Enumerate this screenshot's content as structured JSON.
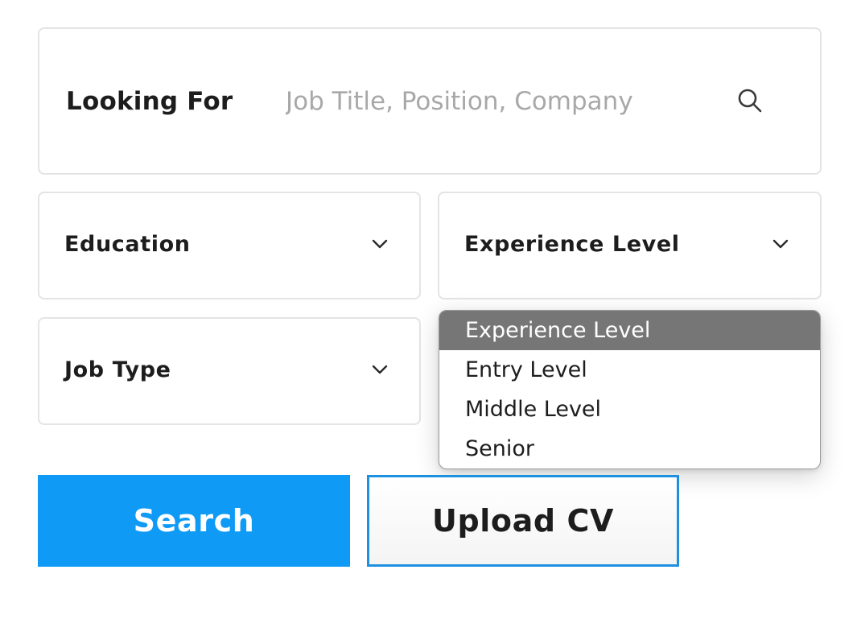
{
  "search": {
    "label": "Looking For",
    "placeholder": "Job Title, Position, Company",
    "value": "",
    "icon": "search-icon"
  },
  "filters": {
    "education": {
      "label": "Education",
      "icon": "chevron-down-icon"
    },
    "experience": {
      "label": "Experience Level",
      "icon": "chevron-down-icon"
    },
    "job_type": {
      "label": "Job Type",
      "icon": "chevron-down-icon"
    }
  },
  "experience_dropdown": {
    "open": true,
    "options": [
      "Experience Level",
      "Entry Level",
      "Middle Level",
      "Senior"
    ],
    "highlighted": "Experience Level"
  },
  "actions": {
    "search_label": "Search",
    "upload_label": "Upload CV"
  },
  "colors": {
    "primary": "#0f9af5",
    "upload_border": "#1e90e0",
    "option_highlight": "#767676",
    "placeholder": "#a8a8a8"
  }
}
